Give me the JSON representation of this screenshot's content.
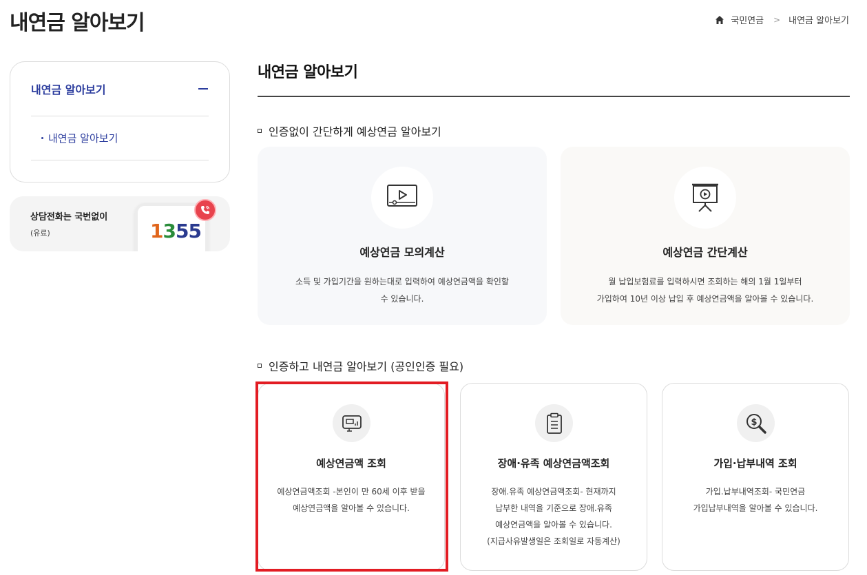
{
  "page": {
    "title": "내연금 알아보기"
  },
  "breadcrumb": {
    "home": "국민연금",
    "current": "내연금 알아보기"
  },
  "lnb": {
    "title": "내연금 알아보기",
    "sub_item": "내연금 알아보기"
  },
  "call": {
    "title": "상담전화는 국번없이",
    "sub": "(유료)",
    "num_1": "1",
    "num_2": "3",
    "num_3": "55"
  },
  "main": {
    "title": "내연금 알아보기"
  },
  "section1": {
    "title": "인증없이 간단하게 예상연금 알아보기",
    "cards": [
      {
        "title": "예상연금 모의계산",
        "desc_1": "소득 및 가입기간을 원하는대로 입력하여 예상연금액을 확인할",
        "desc_2": "수 있습니다."
      },
      {
        "title": "예상연금 간단계산",
        "desc_1": "월 납입보험료를 입력하시면 조회하는 해의 1월 1일부터",
        "desc_2": "가입하여 10년 이상 납입 후 예상연금액을 알아볼 수 있습니다."
      }
    ]
  },
  "section2": {
    "title": "인증하고 내연금 알아보기 (공인인증 필요)",
    "cards": [
      {
        "title": "예상연금액 조회",
        "desc_1": "예상연금액조회 -본인이 만 60세 이후 받을",
        "desc_2": "예상연금액을 알아볼 수 있습니다."
      },
      {
        "title": "장애·유족 예상연금액조회",
        "desc_1": "장애.유족 예상연금액조회- 현재까지",
        "desc_2": "납부한 내역을 기준으로 장애.유족",
        "desc_3": "예상연금액을 알아볼 수 있습니다.",
        "desc_4": "(지급사유발생일은 조회일로 자동계산)"
      },
      {
        "title": "가입·납부내역 조회",
        "desc_1": "가입.납부내역조회- 국민연금",
        "desc_2": "가입납부내역을 알아볼 수 있습니다."
      }
    ]
  },
  "colors": {
    "accent": "#2c3d9e",
    "highlight": "#e21c23",
    "card1_bg": "#f7f8fa",
    "card2_bg": "#faf9f7"
  },
  "icons": [
    "home-icon",
    "chevron-right-icon",
    "minus-icon",
    "phone-call-icon",
    "video-play-icon",
    "presentation-board-icon",
    "monitor-chart-icon",
    "clipboard-icon",
    "dollar-search-icon"
  ]
}
